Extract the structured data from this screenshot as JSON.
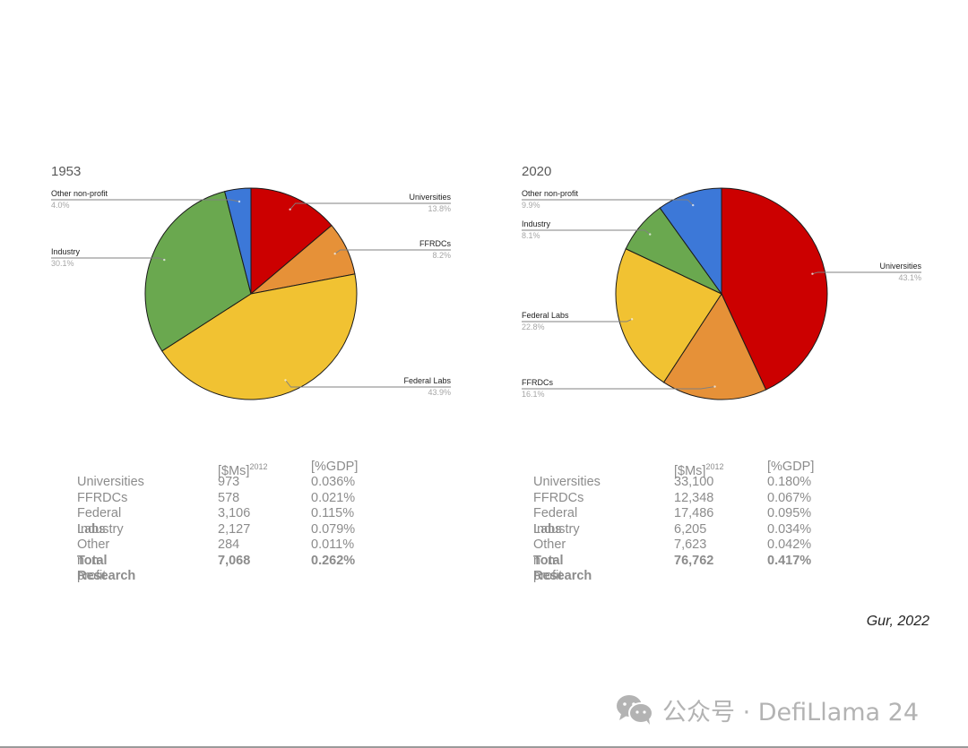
{
  "chart_data": [
    {
      "type": "pie",
      "title": "1953",
      "categories": [
        "Universities",
        "FFRDCs",
        "Federal Labs",
        "Industry",
        "Other non-profit"
      ],
      "values": [
        13.8,
        8.2,
        43.9,
        30.1,
        4.0
      ],
      "value_labels": [
        "13.8%",
        "8.2%",
        "43.9%",
        "30.1%",
        "4.0%"
      ],
      "colors": [
        "#cc0000",
        "#e69138",
        "#f1c232",
        "#6aa84f",
        "#3c78d8"
      ],
      "start": "top, clockwise",
      "legend": "labels with leader lines"
    },
    {
      "type": "pie",
      "title": "2020",
      "categories": [
        "Universities",
        "FFRDCs",
        "Federal Labs",
        "Industry",
        "Other non-profit"
      ],
      "values": [
        43.1,
        16.1,
        22.8,
        8.1,
        9.9
      ],
      "value_labels": [
        "43.1%",
        "16.1%",
        "22.8%",
        "8.1%",
        "9.9%"
      ],
      "colors": [
        "#cc0000",
        "#e69138",
        "#f1c232",
        "#6aa84f",
        "#3c78d8"
      ],
      "start": "top, clockwise",
      "legend": "labels with leader lines"
    },
    {
      "type": "table",
      "title": "1953",
      "columns": [
        "",
        "[$Ms]",
        "[%GDP]"
      ],
      "column_superscripts": [
        "",
        "2012",
        ""
      ],
      "rows": [
        [
          "Universities",
          "973",
          "0.036%"
        ],
        [
          "FFRDCs",
          "578",
          "0.021%"
        ],
        [
          "Federal Labs",
          "3,106",
          "0.115%"
        ],
        [
          "Industry",
          "2,127",
          "0.079%"
        ],
        [
          "Other non-profit",
          "284",
          "0.011%"
        ]
      ],
      "total": [
        "Total Research",
        "7,068",
        "0.262%"
      ]
    },
    {
      "type": "table",
      "title": "2020",
      "columns": [
        "",
        "[$Ms]",
        "[%GDP]"
      ],
      "column_superscripts": [
        "",
        "2012",
        ""
      ],
      "rows": [
        [
          "Universities",
          "33,100",
          "0.180%"
        ],
        [
          "FFRDCs",
          "12,348",
          "0.067%"
        ],
        [
          "Federal Labs",
          "17,486",
          "0.095%"
        ],
        [
          "Industry",
          "6,205",
          "0.034%"
        ],
        [
          "Other non-profit",
          "7,623",
          "0.042%"
        ]
      ],
      "total": [
        "Total Research",
        "76,762",
        "0.417%"
      ]
    }
  ],
  "citation": "Gur, 2022",
  "watermark": {
    "icon": "wechat-icon",
    "text": "公众号 · DefiLlama 24"
  }
}
